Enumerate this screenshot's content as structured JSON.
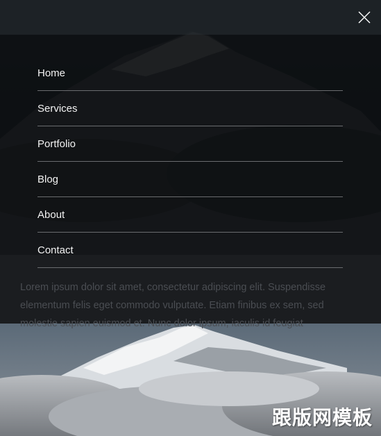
{
  "nav": {
    "items": [
      {
        "label": "Home"
      },
      {
        "label": "Services"
      },
      {
        "label": "Portfolio"
      },
      {
        "label": "Blog"
      },
      {
        "label": "About"
      },
      {
        "label": "Contact"
      }
    ]
  },
  "close_icon": "close-x-icon",
  "body_text": "Lorem ipsum dolor sit amet, consectetur adipiscing elit. Suspendisse elementum felis eget commodo vulputate. Etiam finibus ex sem, sed molestie sapien euismod et. Nunc dolor ipsum, iaculis id feugiat",
  "watermark": "跟版网模板",
  "colors": {
    "menu_bg": "#060708",
    "topbar_bg": "#1b1f22",
    "divider": "#6a6c6f",
    "menu_text": "#f2f2f2"
  }
}
